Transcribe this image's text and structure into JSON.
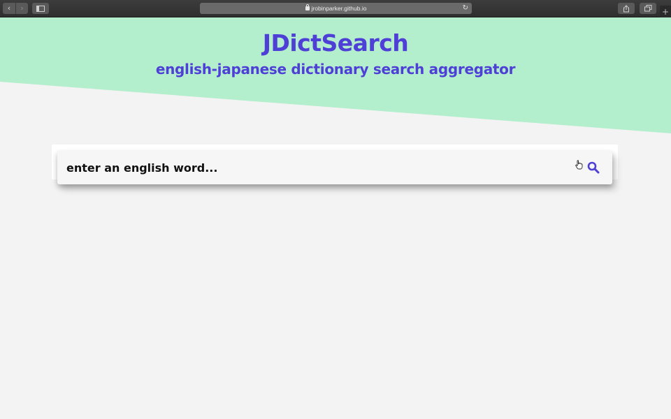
{
  "browser": {
    "url": "jrobinparker.github.io",
    "back_glyph": "‹",
    "forward_glyph": "›",
    "new_tab_glyph": "+",
    "reload_glyph": "↻"
  },
  "header": {
    "title": "JDictSearch",
    "subtitle": "english-japanese dictionary search aggregator"
  },
  "search": {
    "placeholder": "enter an english word...",
    "value": ""
  },
  "colors": {
    "accent": "#4e3fd6",
    "hero_green": "#b3eecd",
    "page_bg": "#f3f3f3"
  },
  "icons": {
    "search": "search-icon",
    "cursor": "hand-pointer-icon"
  }
}
